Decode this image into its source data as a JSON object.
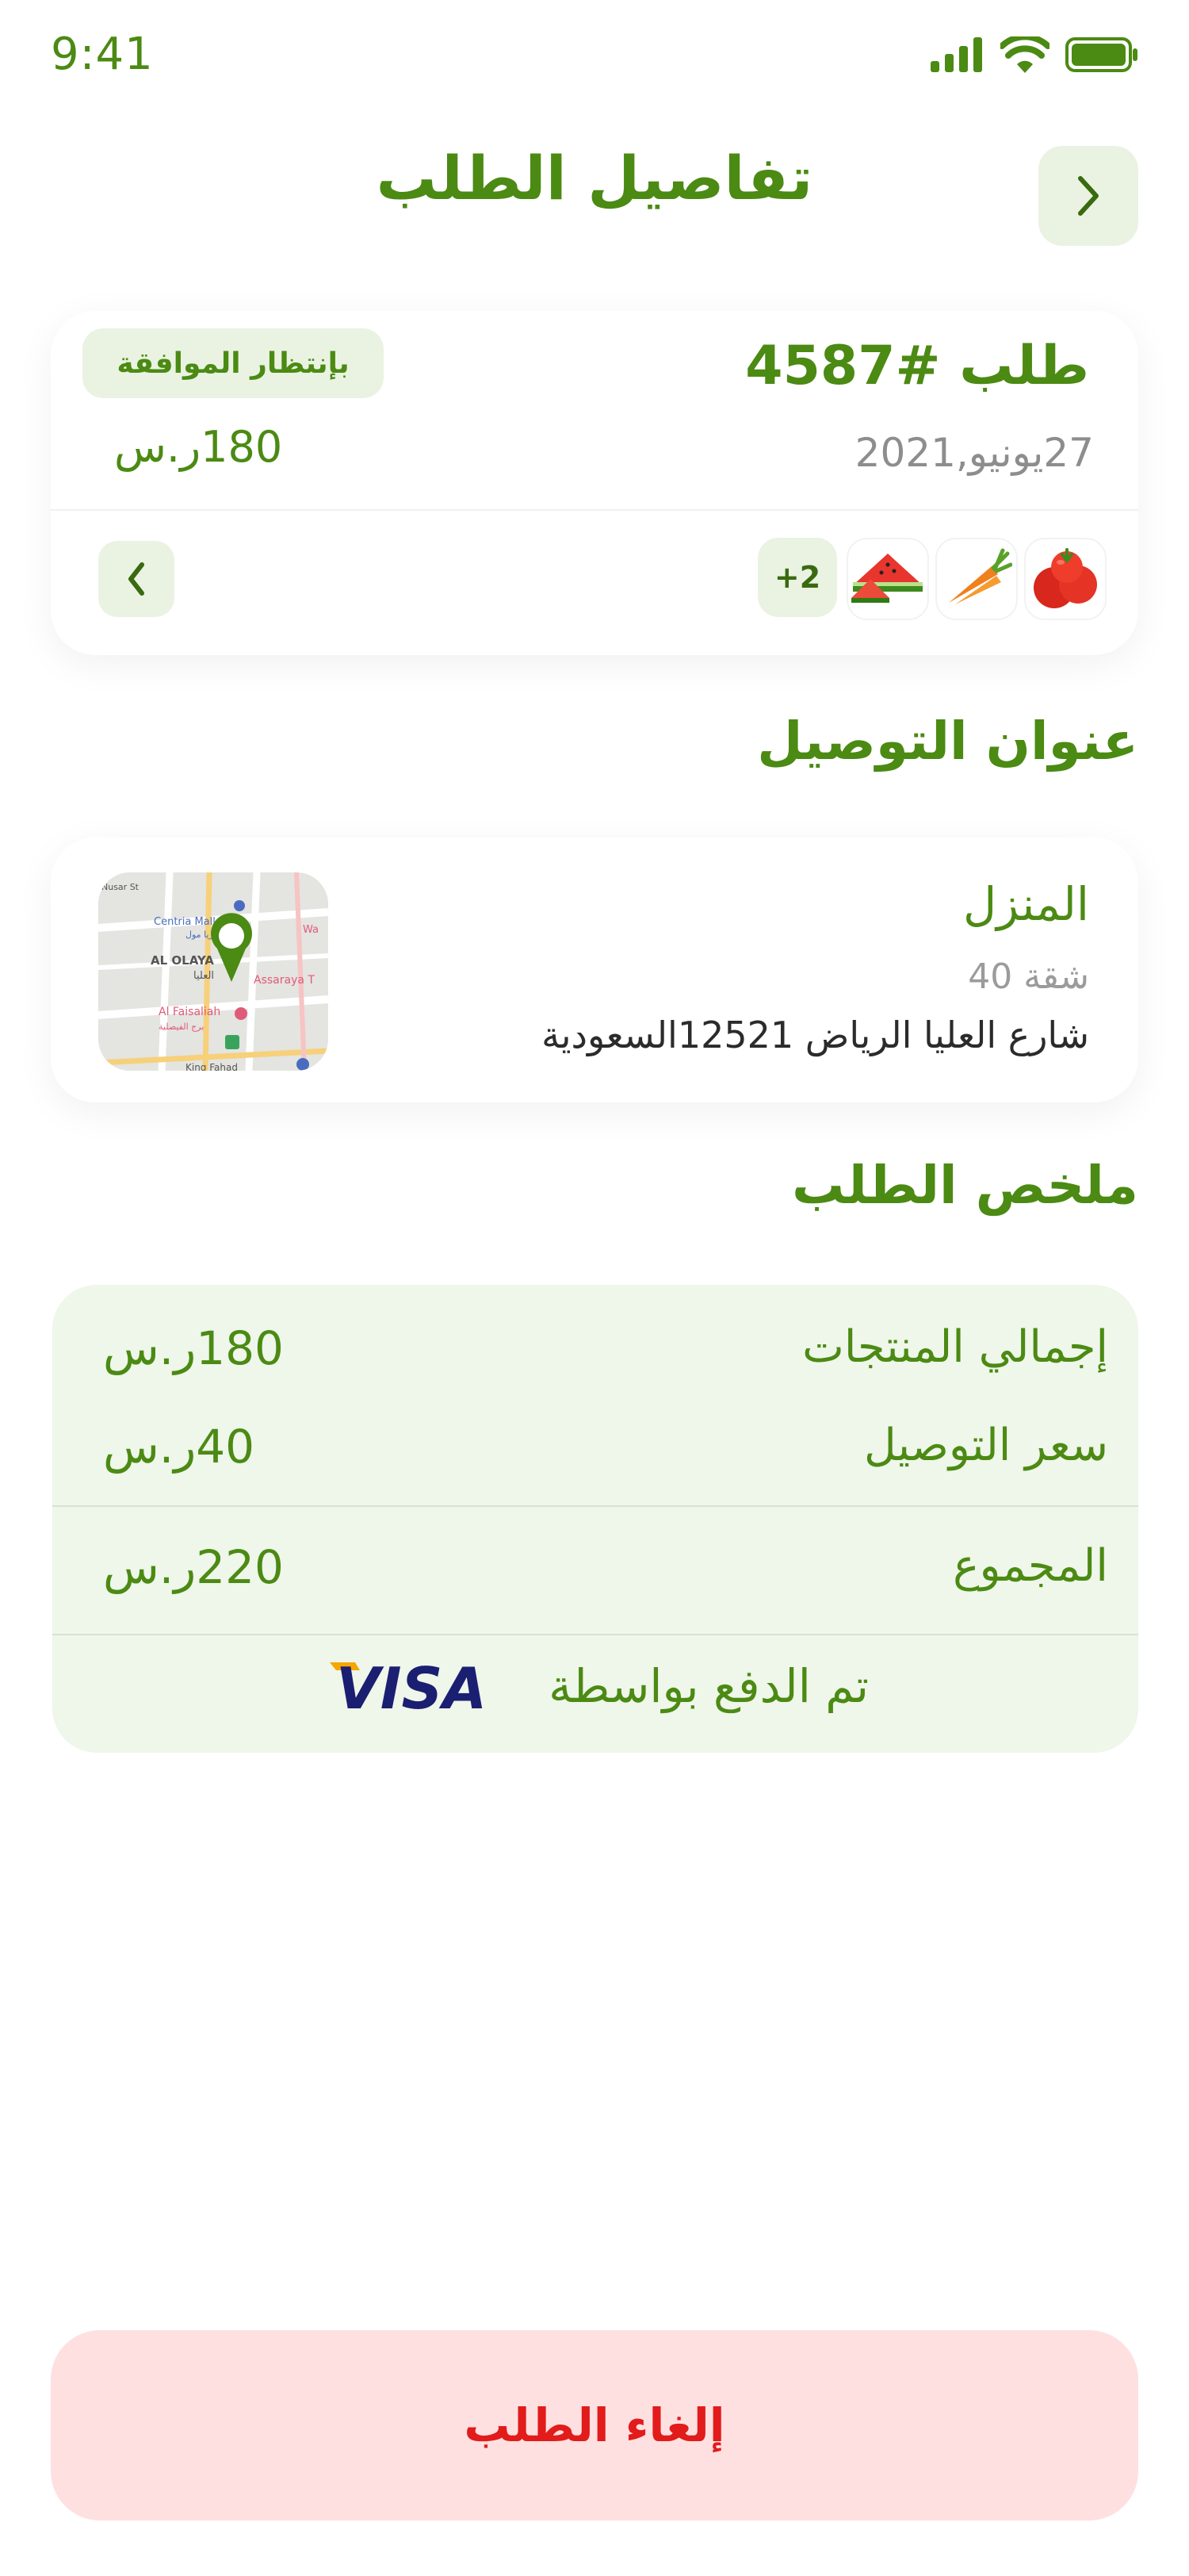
{
  "status_bar": {
    "time": "9:41"
  },
  "header": {
    "title": "تفاصيل الطلب"
  },
  "order": {
    "number": "طلب #4587",
    "status": "بإنتظار الموافقة",
    "date": "27يونيو,2021",
    "price": "180ر.س",
    "items": [
      {
        "icon": "tomato-icon"
      },
      {
        "icon": "carrot-icon"
      },
      {
        "icon": "watermelon-icon"
      }
    ],
    "more_items": "+2"
  },
  "delivery": {
    "section_title": "عنوان التوصيل",
    "name": "المنزل",
    "apartment": "شقة 40",
    "street": "شارع العليا الرياض 12521السعودية",
    "map_labels": {
      "mall": "Centria Mall",
      "mall_ar": "سنتريا مول",
      "district": "AL OLAYA",
      "district_ar": "العليا",
      "faisaliah": "Al Faisaliah",
      "faisaliah_ar": "برج الفيصلية",
      "assaraya": "Assaraya T",
      "wa": "Wa",
      "nusar": "Nusar St",
      "king": "King Fahad"
    }
  },
  "summary": {
    "section_title": "ملخص الطلب",
    "products_label": "إجمالي المنتجات",
    "products_value": "180ر.س",
    "delivery_label": "سعر التوصيل",
    "delivery_value": "40ر.س",
    "total_label": "المجموع",
    "total_value": "220ر.س",
    "payment_label": "تم الدفع بواسطة",
    "payment_method": "VISA"
  },
  "actions": {
    "cancel_label": "إلغاء الطلب"
  },
  "colors": {
    "primary": "#4b8a13",
    "light_green": "#eaf3e2",
    "summary_bg": "#eff6ea",
    "cancel_bg": "#ffe0e0",
    "cancel_text": "#e21b1b",
    "visa_blue": "#1a1f71",
    "visa_gold": "#f7a600"
  }
}
